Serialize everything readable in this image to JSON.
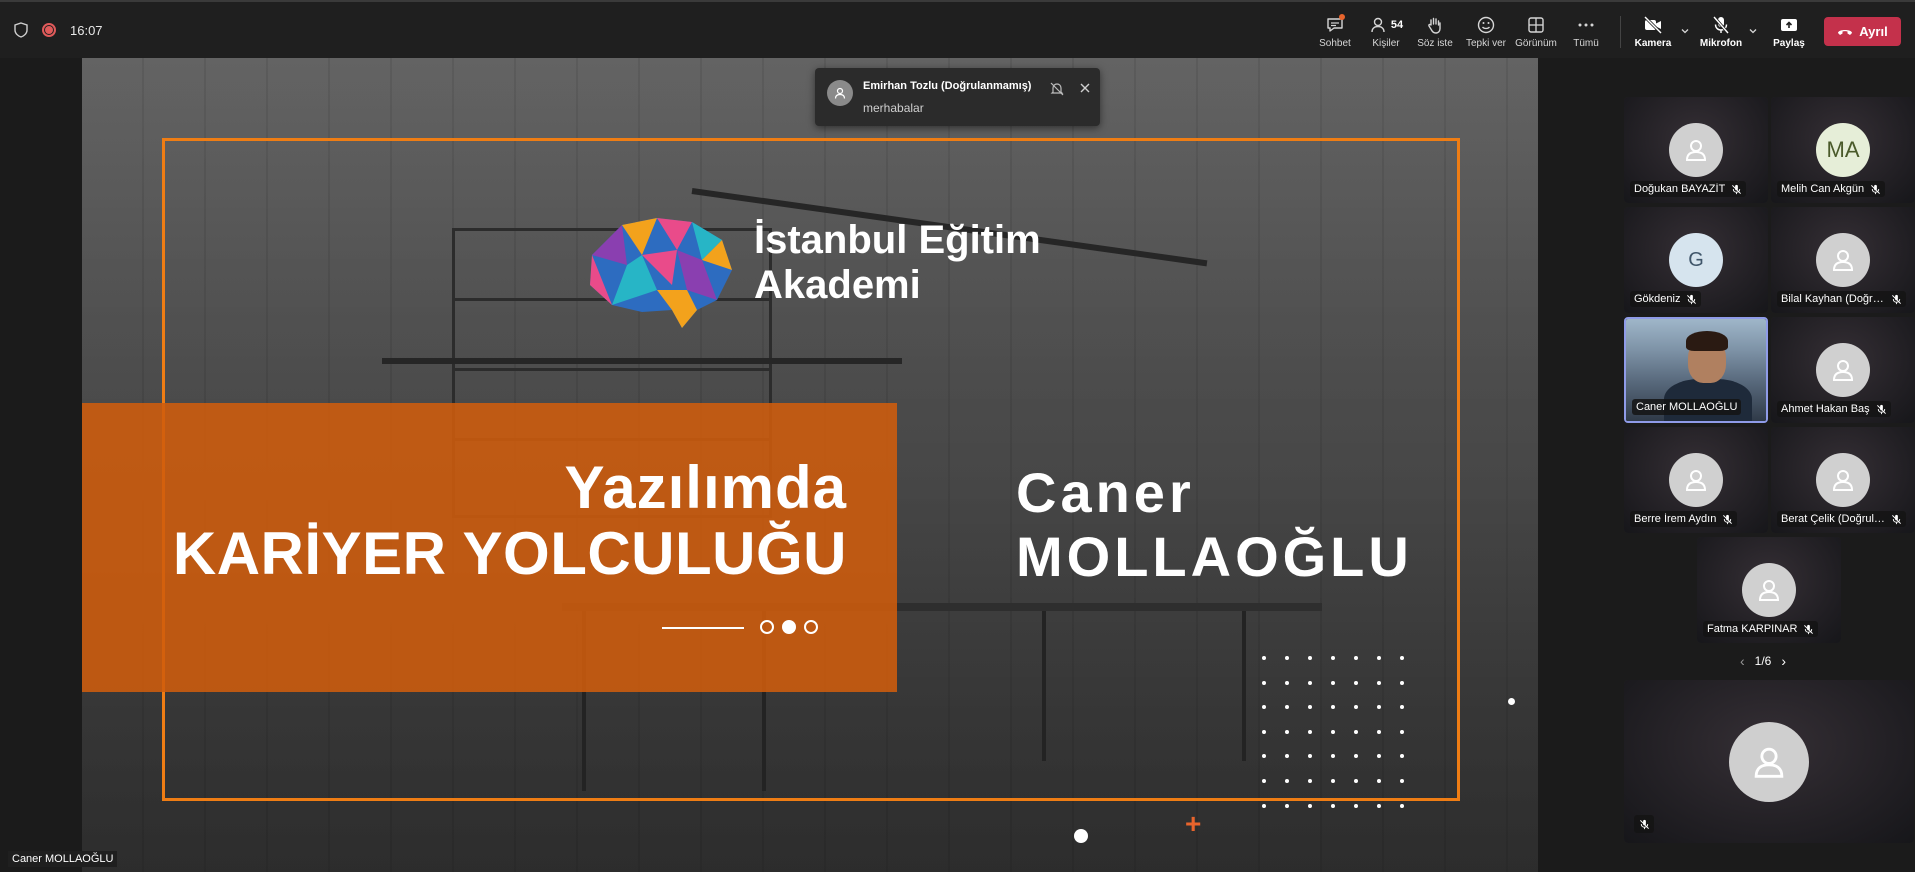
{
  "topbar": {
    "time": "16:07",
    "buttons": {
      "chat": "Sohbet",
      "people": "Kişiler",
      "people_count": "54",
      "raise_hand": "Söz iste",
      "react": "Tepki ver",
      "view": "Görünüm",
      "more": "Tümü",
      "camera": "Kamera",
      "mic": "Mikrofon",
      "share": "Paylaş",
      "leave": "Ayrıl"
    },
    "colors": {
      "leave": "#c4314b",
      "record": "#e05a5a"
    }
  },
  "notification": {
    "sender": "Emirhan Tozlu (Doğrulanmamış)",
    "message": "merhabalar"
  },
  "slide": {
    "brand_line1": "İstanbul Eğitim",
    "brand_line2": "Akademi",
    "title_line1": "Yazılımda",
    "title_line2": "KARİYER YOLCULUĞU",
    "presenter_first": "Caner",
    "presenter_last": "MOLLAOĞLU",
    "accent_color": "#ef7d14"
  },
  "self_label": "Caner MOLLAOĞLU",
  "participants": [
    {
      "name": "Doğukan BAYAZİT",
      "avatar": "person-icon",
      "initials": "",
      "muted": true
    },
    {
      "name": "Melih Can Akgün",
      "avatar": "initials",
      "initials": "MA",
      "muted": true
    },
    {
      "name": "Gökdeniz",
      "avatar": "initials",
      "initials": "G",
      "muted": true
    },
    {
      "name": "Bilal Kayhan (Doğrulanmamış)",
      "avatar": "person-icon",
      "initials": "",
      "muted": true
    },
    {
      "name": "Caner MOLLAOĞLU",
      "avatar": "video",
      "initials": "",
      "muted": false
    },
    {
      "name": "Ahmet Hakan Baş",
      "avatar": "person-icon",
      "initials": "",
      "muted": true
    },
    {
      "name": "Berre İrem Aydın",
      "avatar": "person-icon",
      "initials": "",
      "muted": true
    },
    {
      "name": "Berat Çelik (Doğrulanmamış)",
      "avatar": "person-icon",
      "initials": "",
      "muted": true
    },
    {
      "name": "Fatma KARPINAR",
      "avatar": "person-icon",
      "initials": "",
      "muted": true
    }
  ],
  "pager": {
    "label": "1/6"
  }
}
